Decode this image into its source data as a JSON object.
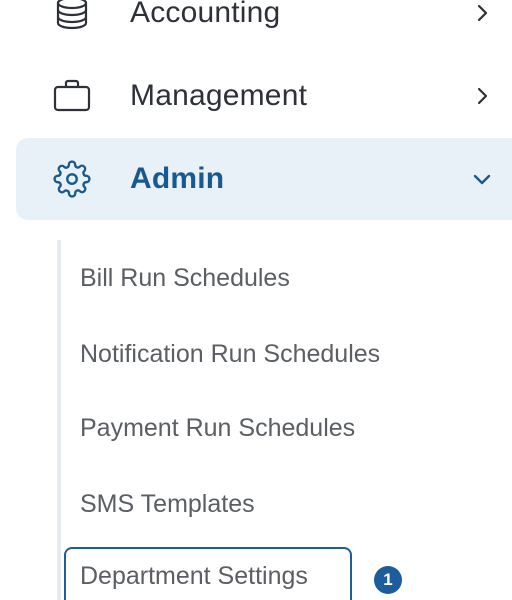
{
  "nav": {
    "items": [
      {
        "label": "Accounting",
        "icon": "coins-stack-icon",
        "chevron": "chevron-right-icon"
      },
      {
        "label": "Management",
        "icon": "briefcase-icon",
        "chevron": "chevron-right-icon"
      },
      {
        "label": "Admin",
        "icon": "gear-icon",
        "chevron": "chevron-down-icon",
        "expanded": true,
        "active": true
      }
    ],
    "admin_submenu": [
      {
        "label": "Bill Run Schedules"
      },
      {
        "label": "Notification Run Schedules"
      },
      {
        "label": "Payment Run Schedules"
      },
      {
        "label": "SMS Templates"
      },
      {
        "label": "Department Settings",
        "focused": true
      }
    ],
    "badge_count": "1"
  },
  "colors": {
    "accent": "#1d5d9b",
    "active_bg": "#e9f1f8",
    "text_primary": "#2e3138",
    "text_secondary": "#5b5e63"
  }
}
